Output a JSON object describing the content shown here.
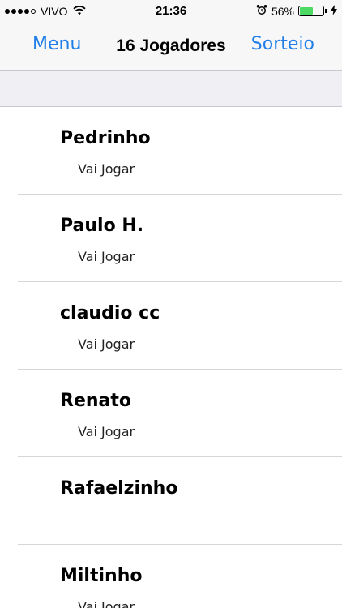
{
  "status_bar": {
    "carrier": "VIVO",
    "time": "21:36",
    "battery_percent": "56%",
    "battery_level": 0.56,
    "signal_bars": 4,
    "signal_total": 5
  },
  "nav": {
    "left_label": "Menu",
    "title": "16 Jogadores",
    "right_label": "Sorteio",
    "accent_color": "#1f7ee8"
  },
  "players": [
    {
      "name": "Pedrinho",
      "status": "Vai Jogar"
    },
    {
      "name": "Paulo H.",
      "status": "Vai Jogar"
    },
    {
      "name": "claudio cc",
      "status": "Vai Jogar"
    },
    {
      "name": "Renato",
      "status": "Vai Jogar"
    },
    {
      "name": "Rafaelzinho",
      "status": ""
    },
    {
      "name": "Miltinho",
      "status": "Vai Jogar"
    }
  ]
}
